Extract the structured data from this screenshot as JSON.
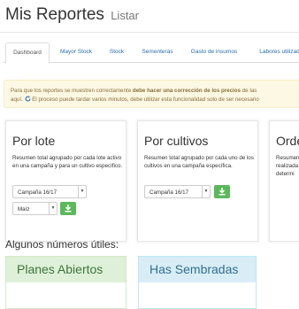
{
  "header": {
    "title": "Mis Reportes",
    "subtitle": "Listar"
  },
  "tabs": [
    {
      "label": "Dashboard"
    },
    {
      "label": "Mayor Stock"
    },
    {
      "label": "Stock"
    },
    {
      "label": "Sementeras"
    },
    {
      "label": "Gasto de insumos"
    },
    {
      "label": "Labores utilizad"
    }
  ],
  "alert": {
    "line1_pre": "Para que los reportes se muestren correctamente ",
    "line1_bold": "debe hacer una corrección de los precios",
    "line1_post": " de las",
    "line2_pre": "aquí.",
    "line2_post": " El proceso puede tardar varios minutos, debe utilizar esta funcionalidad solo de ser necesario"
  },
  "cards": [
    {
      "title": "Por lote",
      "description": "Resumen total agrupado por cada lote activo en una campaña y para un cultivo específico.",
      "campaign_select": "Campaña 16/17",
      "crop_select": "Maíz"
    },
    {
      "title": "Por cultivos",
      "description": "Resumen total agrupado por cada uno de los cultivos en una campaña específica.",
      "campaign_select": "Campaña 16/17"
    },
    {
      "title": "Orde",
      "description": "Resumen realizada determi"
    }
  ],
  "section_heading": "Algunos números útiles:",
  "panels": [
    {
      "title": "Planes Abiertos"
    },
    {
      "title": "Has Sembradas"
    }
  ],
  "colors": {
    "link": "#2a6db0",
    "alert_bg": "#fcf8e3",
    "alert_text": "#8a6d3b",
    "success": "#5cb85c",
    "panel_green_bg": "#dff0d8",
    "panel_blue_bg": "#d9edf7"
  },
  "icons": {
    "refresh": "refresh-icon",
    "download": "download-icon",
    "caret": "chevron-down-icon"
  }
}
